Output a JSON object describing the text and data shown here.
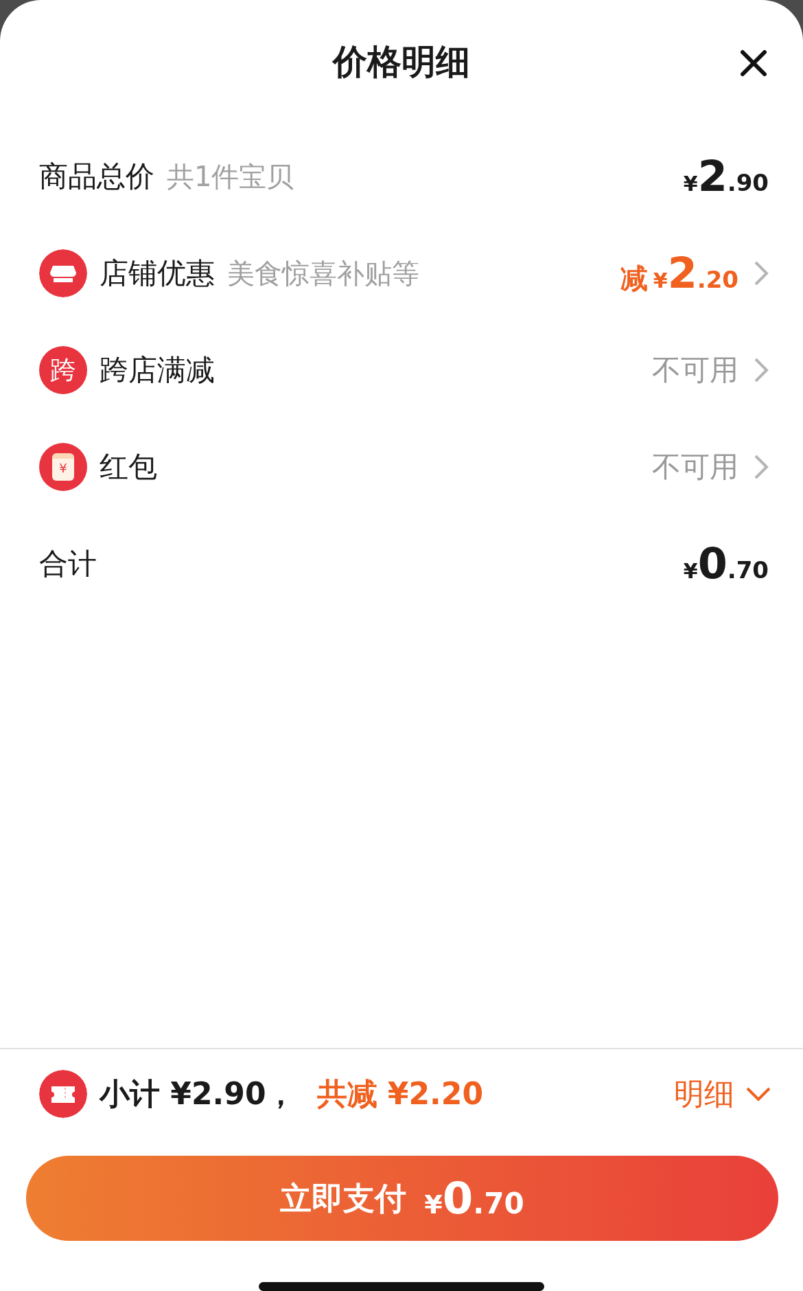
{
  "title": "价格明细",
  "rows": [
    {
      "kind": "plain",
      "label": "商品总价",
      "note": "共1件宝贝",
      "amount": {
        "yen": "¥",
        "whole": "2",
        "fraction": ".90"
      },
      "highlight": false,
      "arrow": false
    },
    {
      "kind": "shop",
      "label": "店铺优惠",
      "note": "美食惊喜补贴等",
      "amount": {
        "prefix": "减",
        "yen": "¥",
        "whole": "2",
        "fraction": ".20"
      },
      "highlight": true,
      "arrow": true
    },
    {
      "kind": "badge",
      "icon_text": "跨",
      "label": "跨店满减",
      "status": "不可用",
      "arrow": true
    },
    {
      "kind": "envelope",
      "icon_text": "¥",
      "label": "红包",
      "status": "不可用",
      "arrow": true
    },
    {
      "kind": "plain",
      "label": "合计",
      "amount": {
        "yen": "¥",
        "whole": "0",
        "fraction": ".70"
      },
      "highlight": false,
      "arrow": false
    }
  ],
  "footer": {
    "subtotal": "小计 ¥2.90，",
    "saved": "共减 ¥2.20",
    "details": "明细",
    "expanded": false
  },
  "pay_button": {
    "label": "立即支付",
    "yen": "¥",
    "whole": "0",
    "fraction": ".70"
  }
}
